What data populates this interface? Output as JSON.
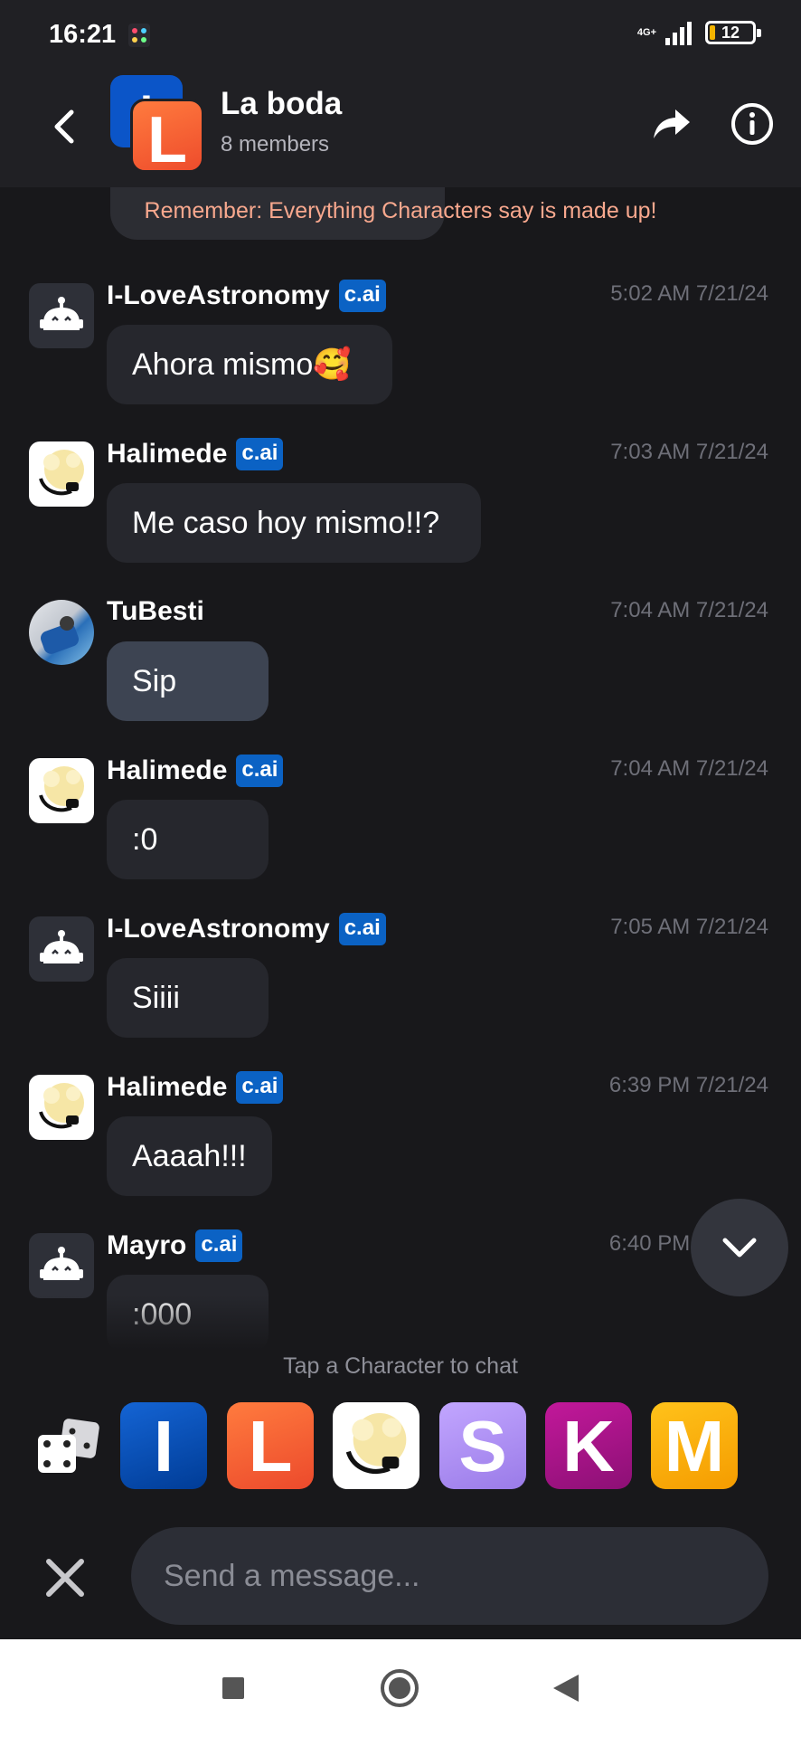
{
  "status_bar": {
    "time": "16:21",
    "network": "4G+",
    "battery": "12"
  },
  "header": {
    "title": "La boda",
    "subtitle": "8 members",
    "avatar_back_letter": "I",
    "avatar_front_letter": "L"
  },
  "disclaimer": "Remember: Everything Characters say is made up!",
  "messages": [
    {
      "sender": "I-LoveAstronomy",
      "badge": "c.ai",
      "time": "5:02 AM 7/21/24",
      "text": "Ahora mismo🥰"
    },
    {
      "sender": "Halimede",
      "badge": "c.ai",
      "time": "7:03 AM 7/21/24",
      "text": "Me caso hoy mismo!!?"
    },
    {
      "sender": "TuBesti",
      "badge": "",
      "time": "7:04 AM 7/21/24",
      "text": "Sip"
    },
    {
      "sender": "Halimede",
      "badge": "c.ai",
      "time": "7:04 AM 7/21/24",
      "text": ":0"
    },
    {
      "sender": "I-LoveAstronomy",
      "badge": "c.ai",
      "time": "7:05 AM 7/21/24",
      "text": "Siiii"
    },
    {
      "sender": "Halimede",
      "badge": "c.ai",
      "time": "6:39 PM 7/21/24",
      "text": "Aaaah!!!"
    },
    {
      "sender": "Mayro",
      "badge": "c.ai",
      "time": "6:40 PM 7/21/24",
      "text": ":000"
    }
  ],
  "tap_hint": "Tap a Character to chat",
  "characters": [
    "I",
    "L",
    "Halimede",
    "S",
    "K",
    "M"
  ],
  "input": {
    "placeholder": "Send a message..."
  },
  "colors": {
    "background": "#18181b",
    "badge": "#0b62c4",
    "disclaimer": "#f8a88e",
    "user_bubble": "#3d4452",
    "bot_bubble": "#26272d"
  },
  "icons": [
    "back-arrow-icon",
    "share-icon",
    "info-icon",
    "robot-icon",
    "dice-icon",
    "close-icon",
    "chevron-down-icon",
    "nav-square-icon",
    "nav-circle-icon",
    "nav-triangle-icon"
  ]
}
